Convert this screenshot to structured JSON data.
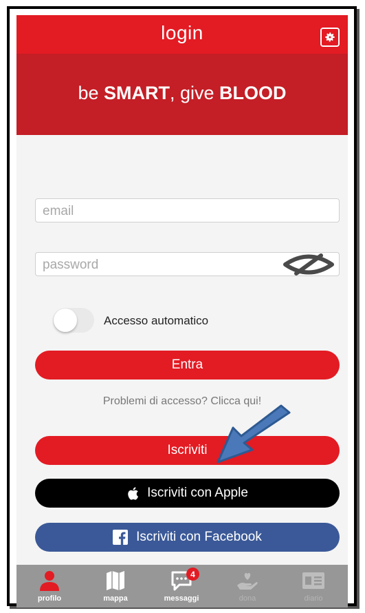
{
  "header": {
    "title": "login",
    "settings_icon": "gear-icon"
  },
  "banner": {
    "prefix": "be ",
    "strong1": "SMART",
    "middle": ", give ",
    "strong2": "BLOOD"
  },
  "form": {
    "email_placeholder": "email",
    "email_value": "",
    "password_placeholder": "password",
    "password_value": "",
    "password_toggle_icon": "hidden-eye-icon",
    "auto_login_label": "Accesso automatico",
    "auto_login_enabled": false,
    "login_button": "Entra",
    "help_link": "Problemi di accesso? Clicca qui!",
    "signup_button": "Iscriviti",
    "apple_button": "Iscriviti con Apple",
    "facebook_button": "Iscriviti con Facebook"
  },
  "tabbar": {
    "tabs": [
      {
        "label": "profilo",
        "icon": "user-icon",
        "active": true
      },
      {
        "label": "mappa",
        "icon": "map-icon",
        "active": false
      },
      {
        "label": "messaggi",
        "icon": "chat-icon",
        "active": false,
        "badge": "4"
      },
      {
        "label": "dona",
        "icon": "donate-hand-icon",
        "active": false
      },
      {
        "label": "diario",
        "icon": "diary-card-icon",
        "active": false
      }
    ]
  },
  "colors": {
    "primary_red": "#e31b23",
    "banner_red": "#c41e26",
    "facebook_blue": "#3b5998",
    "annotation_arrow": "#4a78b8"
  }
}
